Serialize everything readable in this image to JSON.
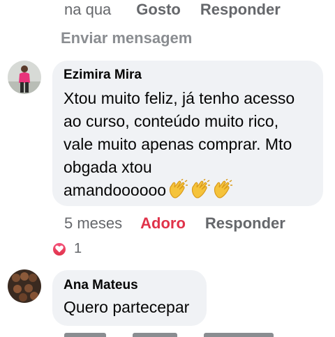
{
  "prev_comment": {
    "time": "na qua",
    "like_label": "Gosto",
    "reply_label": "Responder",
    "send_message_label": "Enviar mensagem"
  },
  "comment1": {
    "author": "Ezimira Mira",
    "text": "Xtou muito feliz, já tenho acesso\nao curso, conteúdo muito rico,\nvale muito apenas comprar.  Mto\nobgada xtou\namandoooooo",
    "emoji": "clapping-hands",
    "emoji_count": 3,
    "time": "5 meses",
    "like_label": "Adoro",
    "reply_label": "Responder",
    "reaction_icon": "heart-icon",
    "reaction_count": "1",
    "liked_color": "#e0334a"
  },
  "comment2": {
    "author": "Ana Mateus",
    "text": "Quero partecepar"
  },
  "colors": {
    "bubble": "#f0f2f5",
    "secondary_text": "#65676b",
    "primary_text": "#050505"
  }
}
